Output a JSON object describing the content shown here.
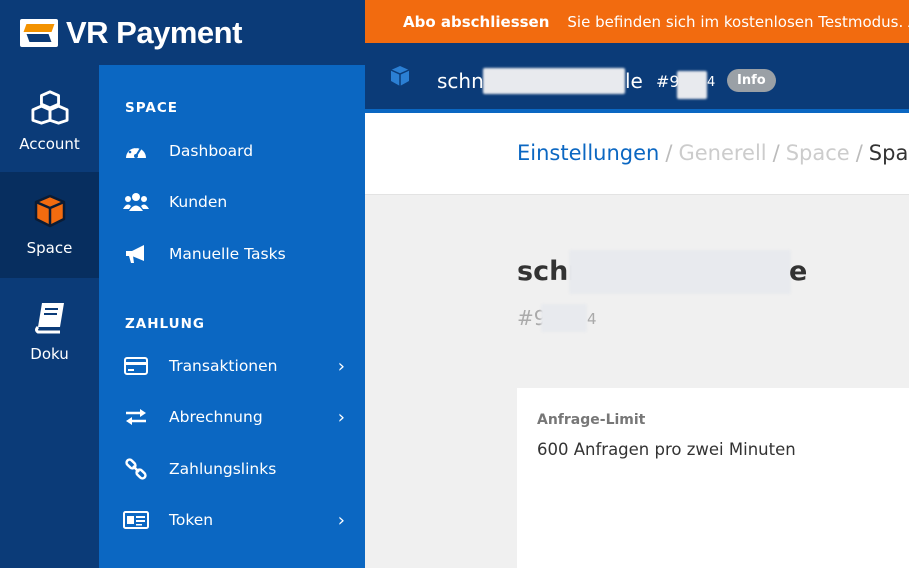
{
  "brand": {
    "name": "VR Payment"
  },
  "rail": {
    "items": [
      {
        "label": "Account",
        "icon": "cubes-icon",
        "active": false
      },
      {
        "label": "Space",
        "icon": "cube-icon",
        "active": true
      },
      {
        "label": "Doku",
        "icon": "book-icon",
        "active": false
      }
    ]
  },
  "subnav": {
    "sections": [
      {
        "title": "SPACE",
        "items": [
          {
            "label": "Dashboard",
            "icon": "dashboard-icon",
            "has_children": false
          },
          {
            "label": "Kunden",
            "icon": "users-icon",
            "has_children": false
          },
          {
            "label": "Manuelle Tasks",
            "icon": "megaphone-icon",
            "has_children": false
          }
        ]
      },
      {
        "title": "ZAHLUNG",
        "items": [
          {
            "label": "Transaktionen",
            "icon": "credit-card-icon",
            "has_children": true
          },
          {
            "label": "Abrechnung",
            "icon": "exchange-icon",
            "has_children": true
          },
          {
            "label": "Zahlungslinks",
            "icon": "link-icon",
            "has_children": false
          },
          {
            "label": "Token",
            "icon": "id-card-icon",
            "has_children": true
          }
        ]
      }
    ]
  },
  "alert": {
    "title": "Abo abschliessen",
    "message": "Sie befinden sich im kostenlosen Testmodus. A",
    "color": "#f26b0f"
  },
  "space_header": {
    "name_start": "schn",
    "name_end": "le",
    "id_prefix": "#9",
    "id_suffix": "4",
    "badge": "Info"
  },
  "breadcrumb": {
    "items": [
      "Einstellungen",
      "Generell",
      "Space",
      "Space"
    ],
    "separator": "/"
  },
  "content": {
    "title_start": "schr",
    "title_end": "e",
    "id_prefix": "#9",
    "id_suffix": "4",
    "card": {
      "label": "Anfrage-Limit",
      "value": "600 Anfragen pro zwei Minuten"
    }
  },
  "colors": {
    "primary_dark": "#0b3b78",
    "primary": "#0b67c2",
    "accent": "#f26b0f"
  }
}
